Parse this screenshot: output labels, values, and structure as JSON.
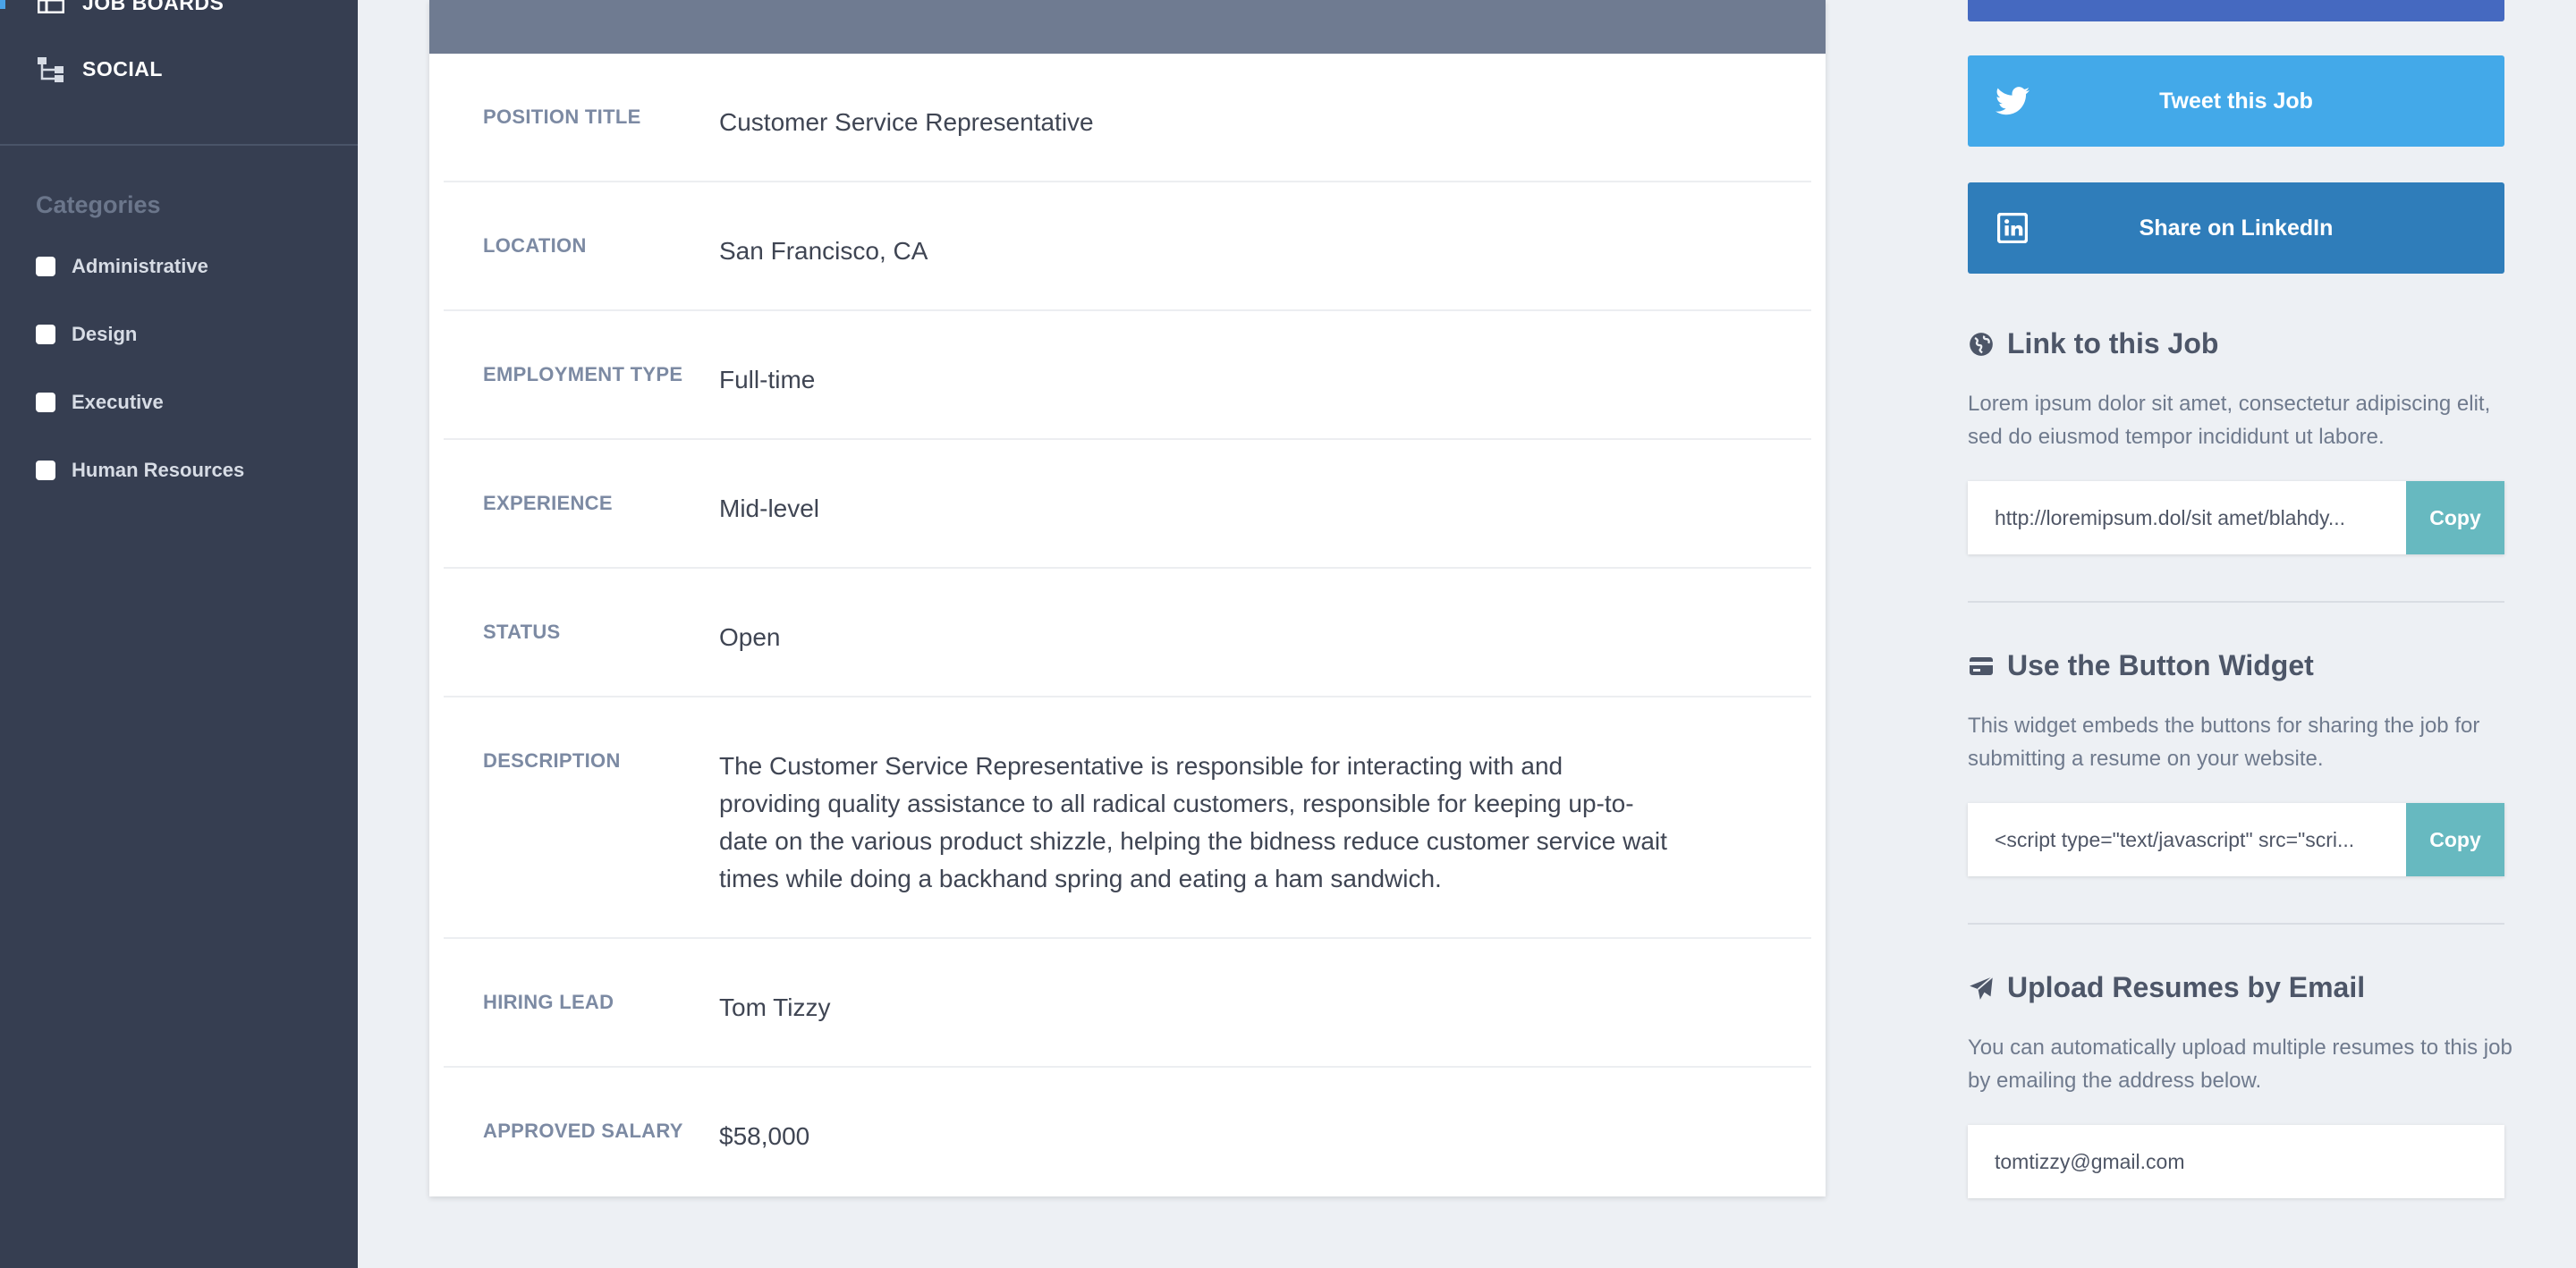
{
  "sidebar": {
    "nav": [
      {
        "label": "JOB BOARDS",
        "icon": "table-icon"
      },
      {
        "label": "SOCIAL",
        "icon": "sitemap-icon"
      }
    ],
    "categories_heading": "Categories",
    "categories": [
      {
        "label": "Administrative"
      },
      {
        "label": "Design"
      },
      {
        "label": "Executive"
      },
      {
        "label": "Human Resources"
      }
    ]
  },
  "job": {
    "rows": [
      {
        "label": "POSITION TITLE",
        "value": "Customer Service Representative"
      },
      {
        "label": "LOCATION",
        "value": "San Francisco, CA"
      },
      {
        "label": "EMPLOYMENT TYPE",
        "value": "Full-time"
      },
      {
        "label": "EXPERIENCE",
        "value": "Mid-level"
      },
      {
        "label": "STATUS",
        "value": "Open"
      },
      {
        "label": "DESCRIPTION",
        "value": "The Customer Service Representative is responsible for interacting with and providing quality assistance to all radical customers, responsible for keeping up-to-date on the various product shizzle, helping the bidness reduce customer service wait times while doing a backhand spring and eating a ham sandwich."
      },
      {
        "label": "HIRING LEAD",
        "value": "Tom Tizzy"
      },
      {
        "label": "APPROVED SALARY",
        "value": "$58,000"
      }
    ]
  },
  "share": {
    "tweet_label": "Tweet this Job",
    "linkedin_label": "Share on LinkedIn"
  },
  "link_section": {
    "title": "Link to this Job",
    "description": "Lorem ipsum dolor sit amet, consectetur adipiscing elit, sed do eiusmod tempor incididunt ut labore.",
    "url": "http://loremipsum.dol/sit amet/blahdy...",
    "copy_label": "Copy"
  },
  "widget_section": {
    "title": "Use the Button Widget",
    "description": "This widget embeds the buttons for sharing the job for submitting a resume on your website.",
    "code": "<script type=\"text/javascript\" src=\"scri...",
    "copy_label": "Copy"
  },
  "email_section": {
    "title": "Upload Resumes by Email",
    "description": "You can automatically upload multiple resumes to this job by emailing the address below.",
    "email": "tomtizzy@gmail.com"
  },
  "colors": {
    "sidebar": "#363e51",
    "twitter": "#43a9e9",
    "linkedin": "#2f7dba",
    "facebook": "#4569c0",
    "copy": "#67b9c0"
  }
}
